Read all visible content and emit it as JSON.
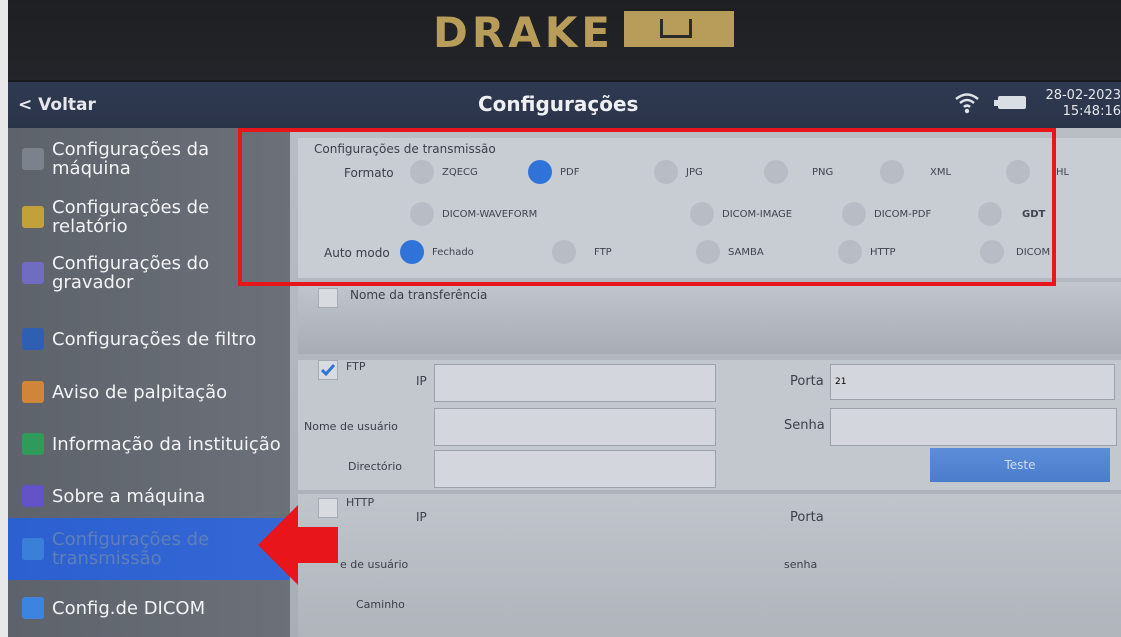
{
  "brand": {
    "text": "DRAKE"
  },
  "header": {
    "back_label": "< Voltar",
    "title": "Configurações",
    "date": "28-02-2023",
    "time": "15:48:16"
  },
  "sidebar": {
    "items": [
      {
        "label": "Configurações da máquina",
        "icon": "machine-settings-icon",
        "color": "#7c828c"
      },
      {
        "label": "Configurações de relatório",
        "icon": "report-settings-icon",
        "color": "#c2a13a"
      },
      {
        "label": "Configurações do gravador",
        "icon": "recorder-settings-icon",
        "color": "#6f6cc2"
      },
      {
        "label": "Configurações de filtro",
        "icon": "filter-settings-icon",
        "color": "#2f5fb3"
      },
      {
        "label": "Aviso de palpitação",
        "icon": "palpitation-warning-icon",
        "color": "#d0853a"
      },
      {
        "label": "Informação da instituição",
        "icon": "institution-info-icon",
        "color": "#2f9a5a"
      },
      {
        "label": "Sobre a máquina",
        "icon": "about-machine-icon",
        "color": "#6452c8"
      },
      {
        "label": "Configurações de transmissão",
        "icon": "transmission-settings-icon",
        "color": "#3a7fd8",
        "active": true
      },
      {
        "label": "Config.de DICOM",
        "icon": "dicom-config-icon",
        "color": "#3c84e0"
      }
    ]
  },
  "transmission": {
    "section_title": "Configurações de transmissão",
    "format_label": "Formato",
    "formats_row1": [
      {
        "label": "ZQECG",
        "selected": false
      },
      {
        "label": "PDF",
        "selected": true
      },
      {
        "label": "JPG",
        "selected": false
      },
      {
        "label": "PNG",
        "selected": false
      },
      {
        "label": "XML",
        "selected": false
      },
      {
        "label": "HL",
        "selected": false
      }
    ],
    "formats_row2": [
      {
        "label": "DICOM-WAVEFORM",
        "selected": false
      },
      {
        "label": "DICOM-IMAGE",
        "selected": false
      },
      {
        "label": "DICOM-PDF",
        "selected": false
      },
      {
        "label": "GDT",
        "selected": false
      }
    ],
    "auto_mode_label": "Auto modo",
    "auto_modes": [
      {
        "label": "Fechado",
        "selected": true
      },
      {
        "label": "FTP",
        "selected": false
      },
      {
        "label": "SAMBA",
        "selected": false
      },
      {
        "label": "HTTP",
        "selected": false
      },
      {
        "label": "DICOM",
        "selected": false
      }
    ],
    "transfer_name_label": "Nome da transferência"
  },
  "ftp": {
    "label": "FTP",
    "checked": true,
    "ip_label": "IP",
    "ip_value": "",
    "port_label": "Porta",
    "port_value": "21",
    "user_label": "Nome de usuário",
    "user_value": "",
    "password_label": "Senha",
    "password_value": "",
    "dir_label": "Directório",
    "dir_value": "",
    "test_label": "Teste"
  },
  "http": {
    "label": "HTTP",
    "checked": false,
    "ip_label": "IP",
    "port_label": "Porta",
    "user_label": "e de usuário",
    "password_label": "senha",
    "path_label": "Caminho"
  },
  "colors": {
    "highlight_box": "#e8151b",
    "arrow": "#e8151b",
    "selected_radio": "#2f73d8",
    "active_item": "#2c5fcf"
  }
}
